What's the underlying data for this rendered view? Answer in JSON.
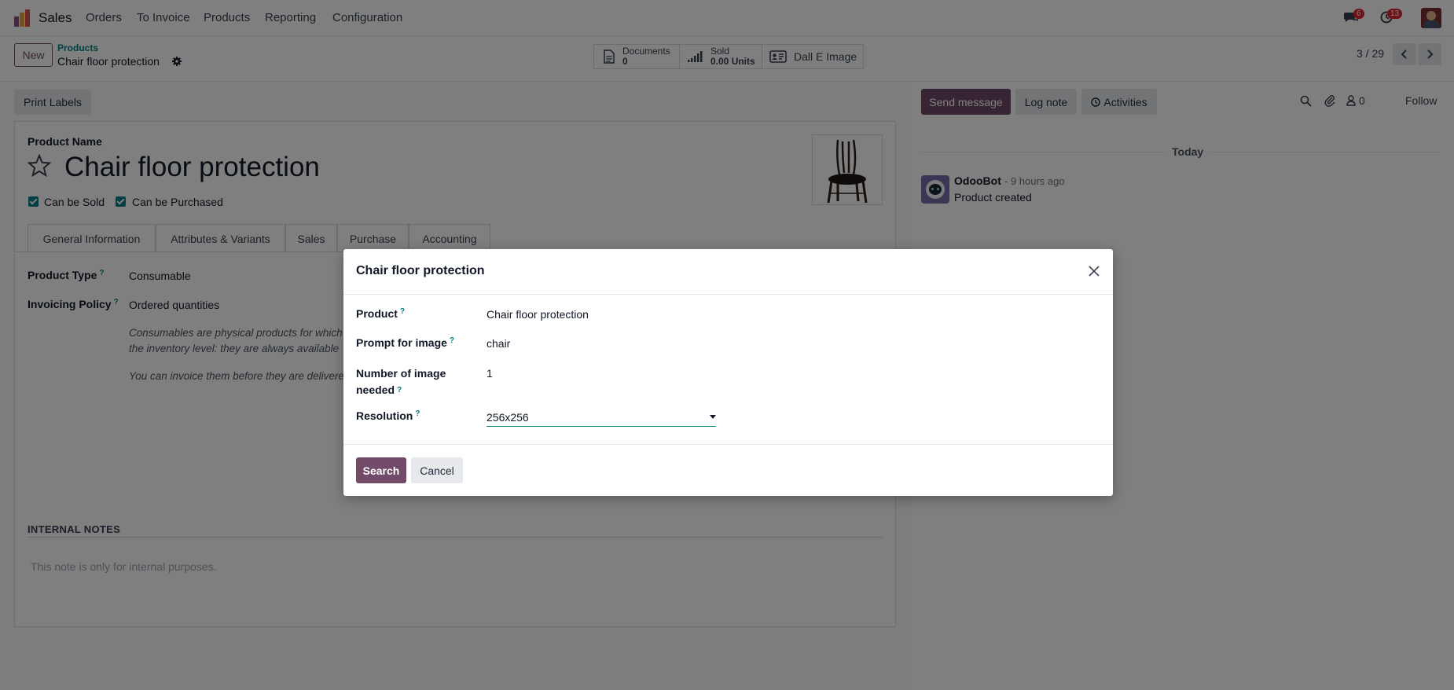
{
  "topnav": {
    "app_name": "Sales",
    "menu": [
      "Orders",
      "To Invoice",
      "Products",
      "Reporting",
      "Configuration"
    ],
    "messages_badge": "6",
    "activities_badge": "13"
  },
  "control_panel": {
    "new_label": "New",
    "breadcrumb_parent": "Products",
    "breadcrumb_current": "Chair floor protection",
    "documents_label": "Documents",
    "documents_count": "0",
    "sold_label": "Sold",
    "sold_value": "0.00 Units",
    "dalle_label": "Dall E Image",
    "pager": "3 / 29"
  },
  "actions": {
    "print_labels": "Print Labels"
  },
  "form": {
    "product_name_label": "Product Name",
    "product_name": "Chair floor protection",
    "can_be_sold": "Can be Sold",
    "can_be_purchased": "Can be Purchased",
    "tabs": [
      "General Information",
      "Attributes & Variants",
      "Sales",
      "Purchase",
      "Accounting"
    ],
    "product_type_label": "Product Type",
    "product_type": "Consumable",
    "invoicing_policy_label": "Invoicing Policy",
    "invoicing_policy": "Ordered quantities",
    "help_line1": "Consumables are physical products for which",
    "help_line2": "the inventory level: they are always available",
    "help_line3": "You can invoice them before they are delivere",
    "internal_notes_title": "INTERNAL NOTES",
    "internal_notes_placeholder": "This note is only for internal purposes."
  },
  "chatter": {
    "send_message": "Send message",
    "log_note": "Log note",
    "activities": "Activities",
    "followers_count": "0",
    "follow": "Follow",
    "date_separator": "Today",
    "author": "OdooBot",
    "time": "- 9 hours ago",
    "message": "Product created"
  },
  "dialog": {
    "title": "Chair floor protection",
    "product_label": "Product",
    "product_value": "Chair floor protection",
    "prompt_label": "Prompt for image",
    "prompt_value": "chair",
    "number_label_1": "Number of image",
    "number_label_2": "needed",
    "number_value": "1",
    "resolution_label": "Resolution",
    "resolution_value": "256x256",
    "search_button": "Search",
    "cancel_button": "Cancel"
  },
  "colors": {
    "primary": "#714b67",
    "accent": "#017e84",
    "badge": "#e0262e"
  }
}
